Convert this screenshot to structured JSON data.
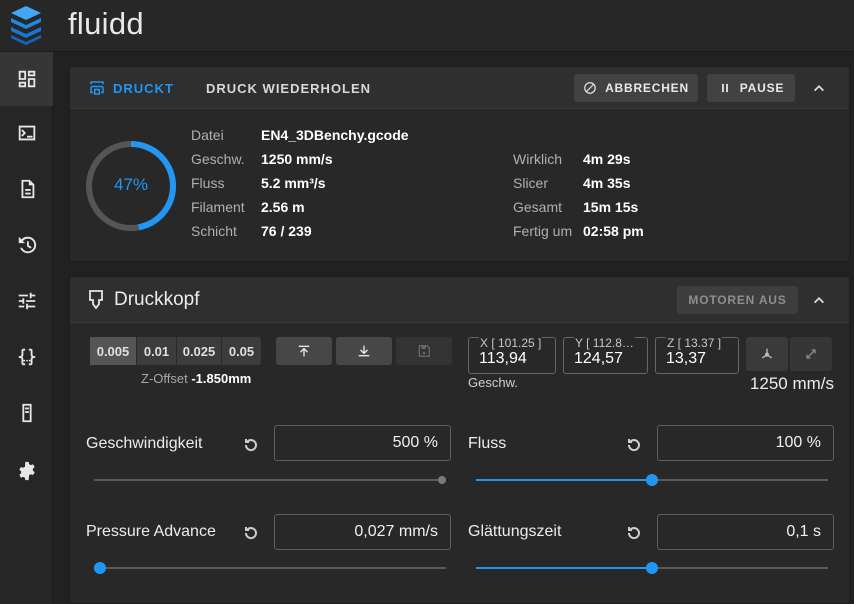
{
  "app": {
    "title": "fluidd"
  },
  "nav": {
    "items": [
      {
        "icon": "dashboard-icon"
      },
      {
        "icon": "console-icon"
      },
      {
        "icon": "file-icon"
      },
      {
        "icon": "history-icon"
      },
      {
        "icon": "tune-icon"
      },
      {
        "icon": "code-braces-icon"
      },
      {
        "icon": "printer-device-icon"
      },
      {
        "icon": "gear-icon"
      }
    ],
    "active_index": 0
  },
  "status_card": {
    "tab_active": "DRUCKT",
    "tab_other": "DRUCK WIEDERHOLEN",
    "cancel_label": "ABBRECHEN",
    "pause_label": "PAUSE",
    "progress_label": "47%",
    "progress_fraction": 0.47,
    "left": [
      {
        "label": "Datei",
        "value": "EN4_3DBenchy.gcode"
      },
      {
        "label": "Geschw.",
        "value": "1250 mm/s"
      },
      {
        "label": "Fluss",
        "value": "5.2 mm³/s"
      },
      {
        "label": "Filament",
        "value": "2.56 m"
      },
      {
        "label": "Schicht",
        "value": "76 / 239"
      }
    ],
    "right": [
      {
        "label": "Wirklich",
        "value": "4m 29s"
      },
      {
        "label": "Slicer",
        "value": "4m 35s"
      },
      {
        "label": "Gesamt",
        "value": "15m 15s"
      },
      {
        "label": "Fertig um",
        "value": "02:58 pm"
      }
    ]
  },
  "toolhead_card": {
    "title": "Druckkopf",
    "motors_off_label": "MOTOREN AUS",
    "z_steps": [
      "0.005",
      "0.01",
      "0.025",
      "0.05"
    ],
    "z_step_selected": 0,
    "z_offset_label": "Z-Offset",
    "z_offset_value": "-1.850mm",
    "axes": [
      {
        "label": "X [ 101.25 ]",
        "value": "113,94"
      },
      {
        "label": "Y [ 112.8…",
        "value": "124,57"
      },
      {
        "label": "Z [ 13.37 ]",
        "value": "13,37"
      }
    ],
    "speed_label": "Geschw.",
    "speed_value": "1250 mm/s",
    "speed_factor": {
      "label": "Geschwindigkeit",
      "value": "500 %",
      "fraction": 1.0
    },
    "flow_factor": {
      "label": "Fluss",
      "value": "100 %",
      "fraction": 0.5
    },
    "pressure_advance": {
      "label": "Pressure Advance",
      "value": "0,027 mm/s",
      "fraction": 0.0
    },
    "smooth_time": {
      "label": "Glättungszeit",
      "value": "0,1 s",
      "fraction": 0.5
    }
  },
  "colors": {
    "accent": "#2196f3",
    "background": "#212121",
    "card": "#282828"
  }
}
